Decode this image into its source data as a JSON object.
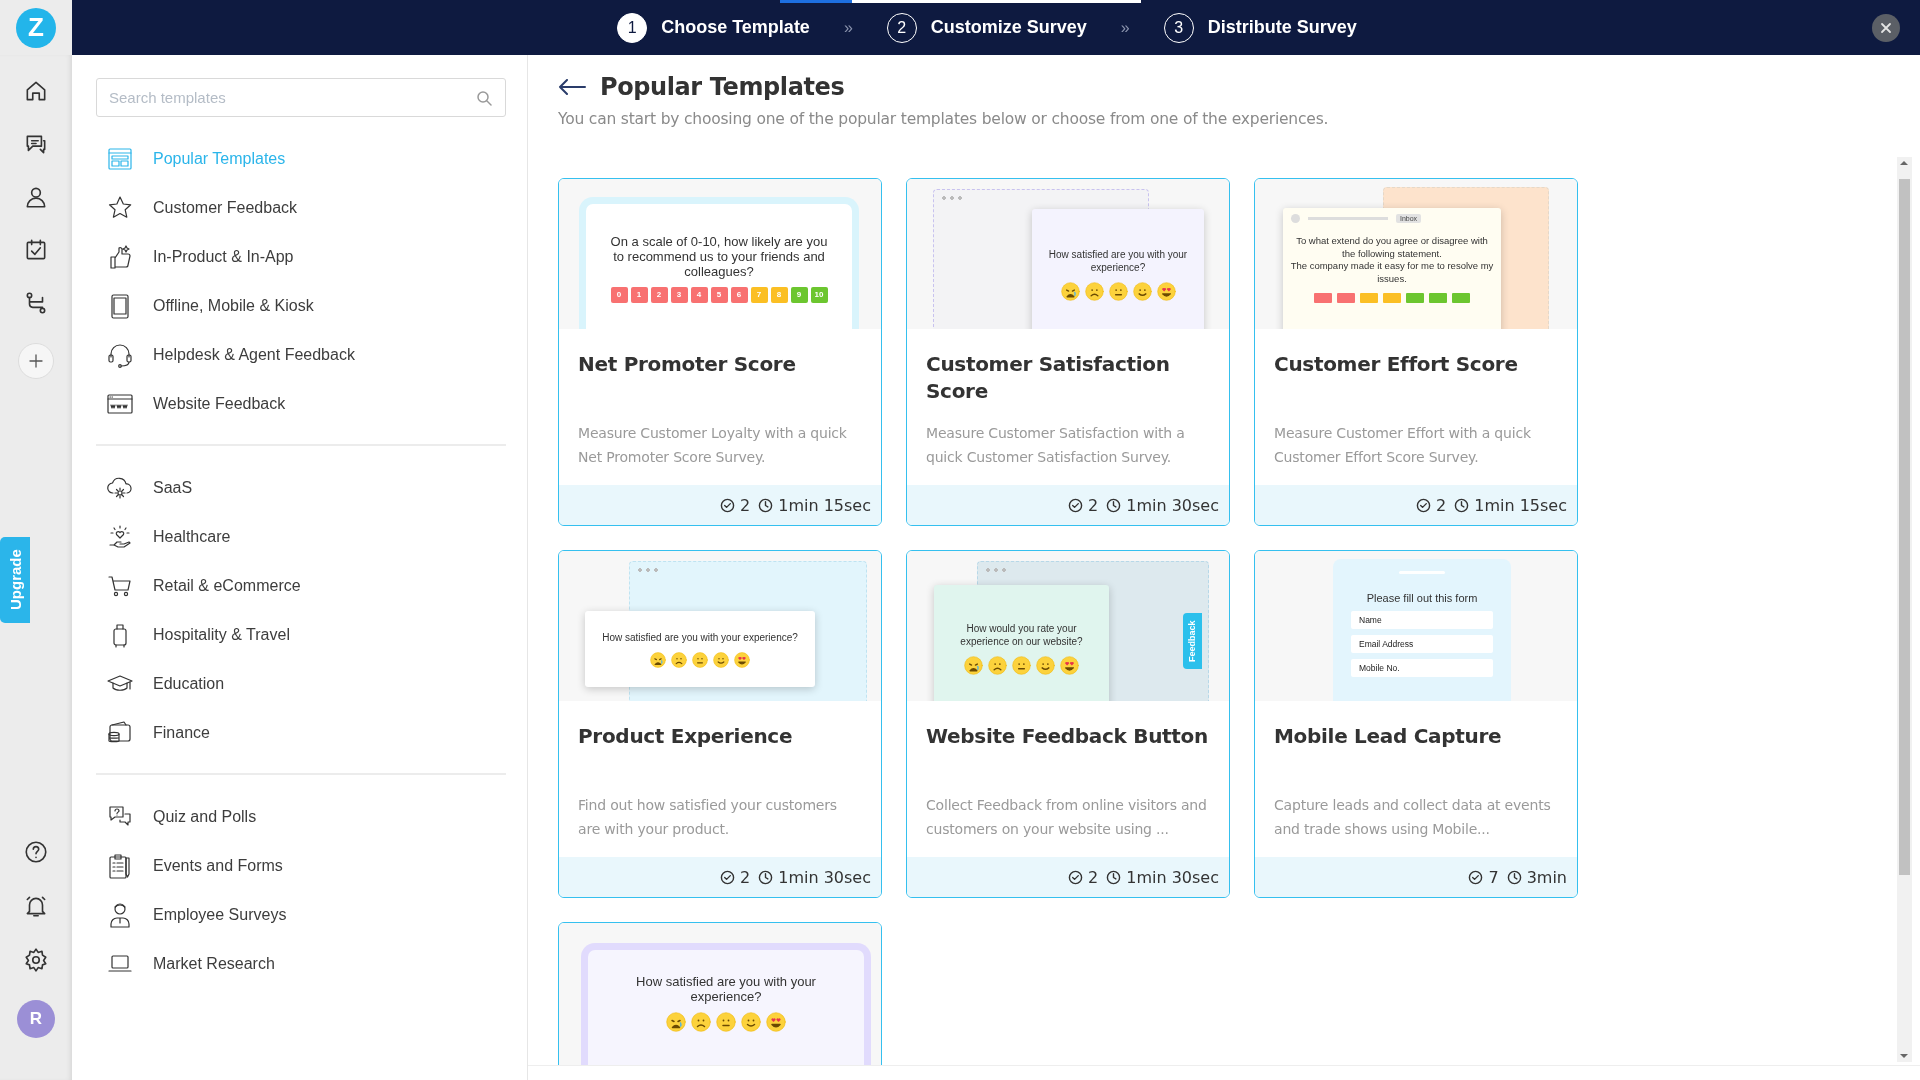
{
  "top_bar": {
    "logo": "Z",
    "progress": {
      "level": 0.2
    },
    "steps": [
      {
        "number": "1",
        "label": "Choose Template",
        "selected": true
      },
      {
        "number": "2",
        "label": "Customize Survey",
        "selected": false
      },
      {
        "number": "3",
        "label": "Distribute Survey",
        "selected": false
      }
    ],
    "separators": [
      "»",
      "»"
    ]
  },
  "rail": {
    "upgrade": "Upgrade",
    "avatar": "R"
  },
  "sidebar": {
    "search": {
      "placeholder": "Search templates"
    },
    "groups": [
      {
        "items": [
          {
            "label": "Popular Templates",
            "selected": true
          },
          {
            "label": "Customer Feedback",
            "selected": false
          },
          {
            "label": "In-Product & In-App",
            "selected": false
          },
          {
            "label": "Offline, Mobile & Kiosk",
            "selected": false
          },
          {
            "label": "Helpdesk & Agent Feedback",
            "selected": false
          },
          {
            "label": "Website Feedback",
            "selected": false
          }
        ]
      },
      {
        "items": [
          {
            "label": "SaaS",
            "selected": false
          },
          {
            "label": "Healthcare",
            "selected": false
          },
          {
            "label": "Retail & eCommerce",
            "selected": false
          },
          {
            "label": "Hospitality & Travel",
            "selected": false
          },
          {
            "label": "Education",
            "selected": false
          },
          {
            "label": "Finance",
            "selected": false
          }
        ]
      },
      {
        "items": [
          {
            "label": "Quiz and Polls",
            "selected": false
          },
          {
            "label": "Events and Forms",
            "selected": false
          },
          {
            "label": "Employee Surveys",
            "selected": false
          },
          {
            "label": "Market Research",
            "selected": false
          }
        ]
      }
    ]
  },
  "main": {
    "title": "Popular Templates",
    "subtitle": "You can start by choosing one of the popular templates below or choose from one of the experiences.",
    "cards": [
      {
        "title": "Net Promoter Score",
        "description": "Measure Customer Loyalty with a quick Net Promoter Score Survey.",
        "questions": "2",
        "duration": "1min 15sec",
        "preview": {
          "kind": "nps",
          "question": "On a scale of 0-10, how likely are you to recommend us to your friends and colleagues?",
          "scale": [
            {
              "label": "0",
              "color": "#f87171"
            },
            {
              "label": "1",
              "color": "#f87171"
            },
            {
              "label": "2",
              "color": "#f87171"
            },
            {
              "label": "3",
              "color": "#f87171"
            },
            {
              "label": "4",
              "color": "#f87171"
            },
            {
              "label": "5",
              "color": "#f87171"
            },
            {
              "label": "6",
              "color": "#f87171"
            },
            {
              "label": "7",
              "color": "#fbbf24"
            },
            {
              "label": "8",
              "color": "#fbbf24"
            },
            {
              "label": "9",
              "color": "#6cc62f"
            },
            {
              "label": "10",
              "color": "#6cc62f"
            }
          ]
        }
      },
      {
        "title": "Customer Satisfaction Score",
        "description": "Measure Customer Satisfaction with a quick Customer Satisfaction Survey.",
        "questions": "2",
        "duration": "1min 30sec",
        "preview": {
          "kind": "dialog",
          "question": "How satisfied are you with your experience?"
        }
      },
      {
        "title": "Customer Effort Score",
        "description": "Measure Customer Effort with a quick Customer Effort Score Survey.",
        "questions": "2",
        "duration": "1min 15sec",
        "preview": {
          "kind": "email",
          "tag": "Inbox",
          "question": "To what extend do you agree or disagree with the following statement.",
          "statement": "The company made it easy for me to resolve my issues.",
          "scale": [
            {
              "color": "#f87171"
            },
            {
              "color": "#f87171"
            },
            {
              "color": "#fbbf24"
            },
            {
              "color": "#fbbf24"
            },
            {
              "color": "#6cc62f"
            },
            {
              "color": "#6cc62f"
            },
            {
              "color": "#6cc62f"
            }
          ]
        }
      },
      {
        "title": "Product Experience",
        "description": "Find out how satisfied your customers are with your product.",
        "questions": "2",
        "duration": "1min 30sec",
        "preview": {
          "kind": "popup",
          "question": "How satisfied are you with your experience?"
        }
      },
      {
        "title": "Website Feedback Button",
        "description": "Collect Feedback from online visitors and customers on your website using ...",
        "questions": "2",
        "duration": "1min 30sec",
        "preview": {
          "kind": "feedback-tab",
          "question": "How would you rate your experience on our website?",
          "tab": "Feedback"
        }
      },
      {
        "title": "Mobile Lead Capture",
        "description": "Capture leads and collect data at events and trade shows using Mobile...",
        "questions": "7",
        "duration": "3min",
        "preview": {
          "kind": "form",
          "heading": "Please fill out this form",
          "fields": [
            "Name",
            "Email Address",
            "Mobile No."
          ]
        }
      },
      {
        "preview": {
          "kind": "phone-emoji",
          "question": "How satisfied are you with your experience?"
        }
      }
    ]
  }
}
